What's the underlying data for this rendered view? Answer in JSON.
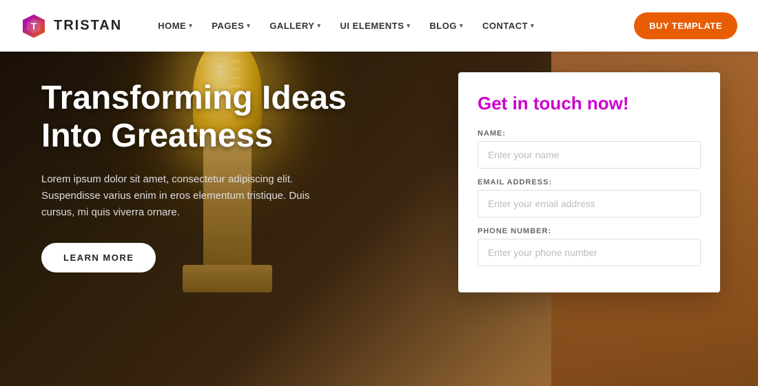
{
  "navbar": {
    "logo_text": "TRISTAN",
    "nav_items": [
      {
        "label": "HOME",
        "has_dropdown": true
      },
      {
        "label": "PAGES",
        "has_dropdown": true
      },
      {
        "label": "GALLERY",
        "has_dropdown": true
      },
      {
        "label": "UI ELEMENTS",
        "has_dropdown": true
      },
      {
        "label": "BLOG",
        "has_dropdown": true
      },
      {
        "label": "CONTACT",
        "has_dropdown": true
      }
    ],
    "buy_button": "BUY TEMPLATE"
  },
  "hero": {
    "title": "Transforming Ideas Into Greatness",
    "description": "Lorem ipsum dolor sit amet, consectetur adipiscing elit. Suspendisse varius enim in eros elementum tristique. Duis cursus, mi quis viverra ornare.",
    "cta_button": "LEARN MORE"
  },
  "contact_form": {
    "title": "Get in touch now!",
    "fields": [
      {
        "label": "NAME:",
        "placeholder": "Enter your name",
        "type": "text"
      },
      {
        "label": "EMAIL ADDRESS:",
        "placeholder": "Enter your email address",
        "type": "email"
      },
      {
        "label": "PHONE NUMBER:",
        "placeholder": "Enter your phone number",
        "type": "tel"
      }
    ]
  },
  "colors": {
    "accent_orange": "#e85d04",
    "accent_purple": "#cc00cc",
    "logo_gradient_start": "#9b00d4",
    "logo_gradient_end": "#e85d04"
  }
}
